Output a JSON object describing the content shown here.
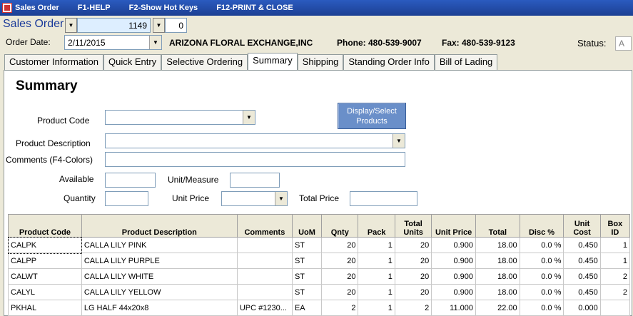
{
  "titlebar": {
    "title": "Sales Order",
    "help": "F1-HELP",
    "hotkeys": "F2-Show Hot Keys",
    "print": "F12-PRINT & CLOSE"
  },
  "header": {
    "form_label": "Sales Order",
    "order_no": "1149",
    "order_sub": "0",
    "order_date_label": "Order Date:",
    "order_date": "2/11/2015",
    "company": "ARIZONA FLORAL EXCHANGE,INC",
    "phone": "Phone: 480-539-9007",
    "fax": "Fax: 480-539-9123",
    "status_label": "Status:",
    "status": "A"
  },
  "tabs": [
    "Customer Information",
    "Quick Entry",
    "Selective Ordering",
    "Summary",
    "Shipping",
    "Standing Order Info",
    "Bill of Lading"
  ],
  "summary": {
    "heading": "Summary",
    "product_code_label": "Product Code",
    "product_desc_label": "Product Description",
    "comments_label": "Comments (F4-Colors)",
    "available_label": "Available",
    "uom_label": "Unit/Measure",
    "quantity_label": "Quantity",
    "unit_price_label": "Unit Price",
    "total_price_label": "Total Price",
    "display_button": "Display/Select Products"
  },
  "grid": {
    "columns": [
      "Product Code",
      "Product Description",
      "Comments",
      "UoM",
      "Qnty",
      "Pack",
      "Total Units",
      "Unit Price",
      "Total",
      "Disc %",
      "Unit Cost",
      "Box ID"
    ],
    "rows": [
      [
        "CALPK",
        "CALLA LILY PINK",
        "",
        "ST",
        "20",
        "1",
        "20",
        "0.900",
        "18.00",
        "0.0 %",
        "0.450",
        "1"
      ],
      [
        "CALPP",
        "CALLA LILY PURPLE",
        "",
        "ST",
        "20",
        "1",
        "20",
        "0.900",
        "18.00",
        "0.0 %",
        "0.450",
        "1"
      ],
      [
        "CALWT",
        "CALLA LILY WHITE",
        "",
        "ST",
        "20",
        "1",
        "20",
        "0.900",
        "18.00",
        "0.0 %",
        "0.450",
        "2"
      ],
      [
        "CALYL",
        "CALLA LILY YELLOW",
        "",
        "ST",
        "20",
        "1",
        "20",
        "0.900",
        "18.00",
        "0.0 %",
        "0.450",
        "2"
      ],
      [
        "PKHAL",
        "LG HALF 44x20x8",
        "UPC #1230...",
        "EA",
        "2",
        "1",
        "2",
        "11.000",
        "22.00",
        "0.0 %",
        "0.000",
        ""
      ]
    ]
  }
}
